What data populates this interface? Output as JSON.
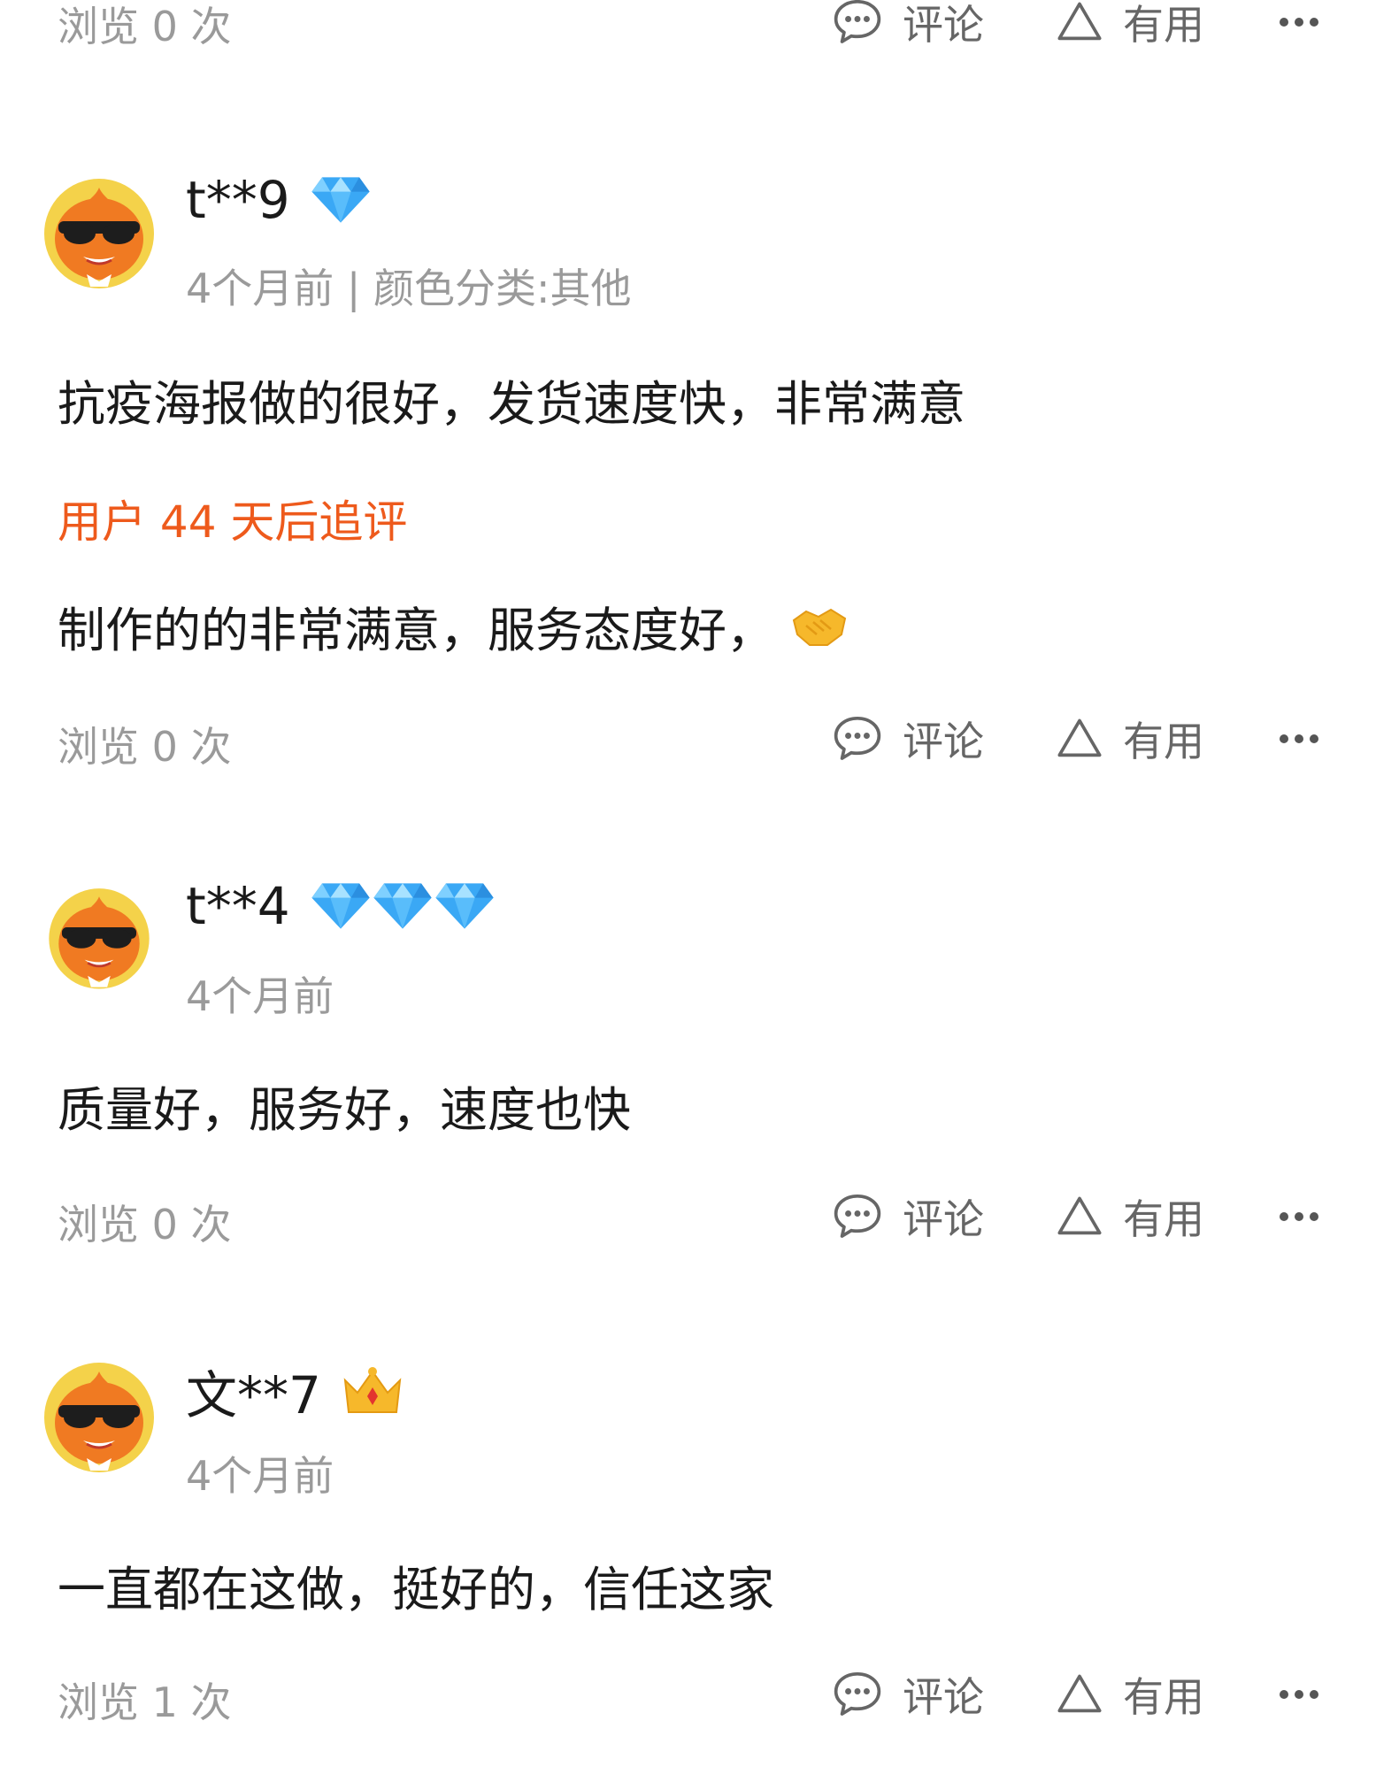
{
  "colors": {
    "accent_followup": "#ee5a1c",
    "muted_text": "#9a9a9a",
    "action_text": "#666666",
    "diamond": "#3aa8f5",
    "crown": "#f6b82b"
  },
  "reviews": [
    {
      "footer": {
        "views_text": "浏览 0 次",
        "comment_label": "评论",
        "useful_label": "有用",
        "more_icon": "more-dots-icon"
      }
    },
    {
      "username": "t**9",
      "badge": {
        "type": "diamond",
        "count": 1
      },
      "meta": "4个月前 | 颜色分类:其他",
      "content": "抗疫海报做的很好，发货速度快，非常满意",
      "followup_label": "用户 44 天后追评",
      "followup_content": "制作的的非常满意，服务态度好，",
      "followup_emoji": "handshake-emoji",
      "footer": {
        "views_text": "浏览 0 次",
        "comment_label": "评论",
        "useful_label": "有用",
        "more_icon": "more-dots-icon"
      }
    },
    {
      "username": "t**4",
      "badge": {
        "type": "diamond",
        "count": 3
      },
      "meta": "4个月前",
      "content": "质量好，服务好，速度也快",
      "footer": {
        "views_text": "浏览 0 次",
        "comment_label": "评论",
        "useful_label": "有用",
        "more_icon": "more-dots-icon"
      }
    },
    {
      "username": "文**7",
      "badge": {
        "type": "crown",
        "count": 1
      },
      "meta": "4个月前",
      "content": "一直都在这做，挺好的，信任这家",
      "footer": {
        "views_text": "浏览 1 次",
        "comment_label": "评论",
        "useful_label": "有用",
        "more_icon": "more-dots-icon"
      }
    }
  ]
}
